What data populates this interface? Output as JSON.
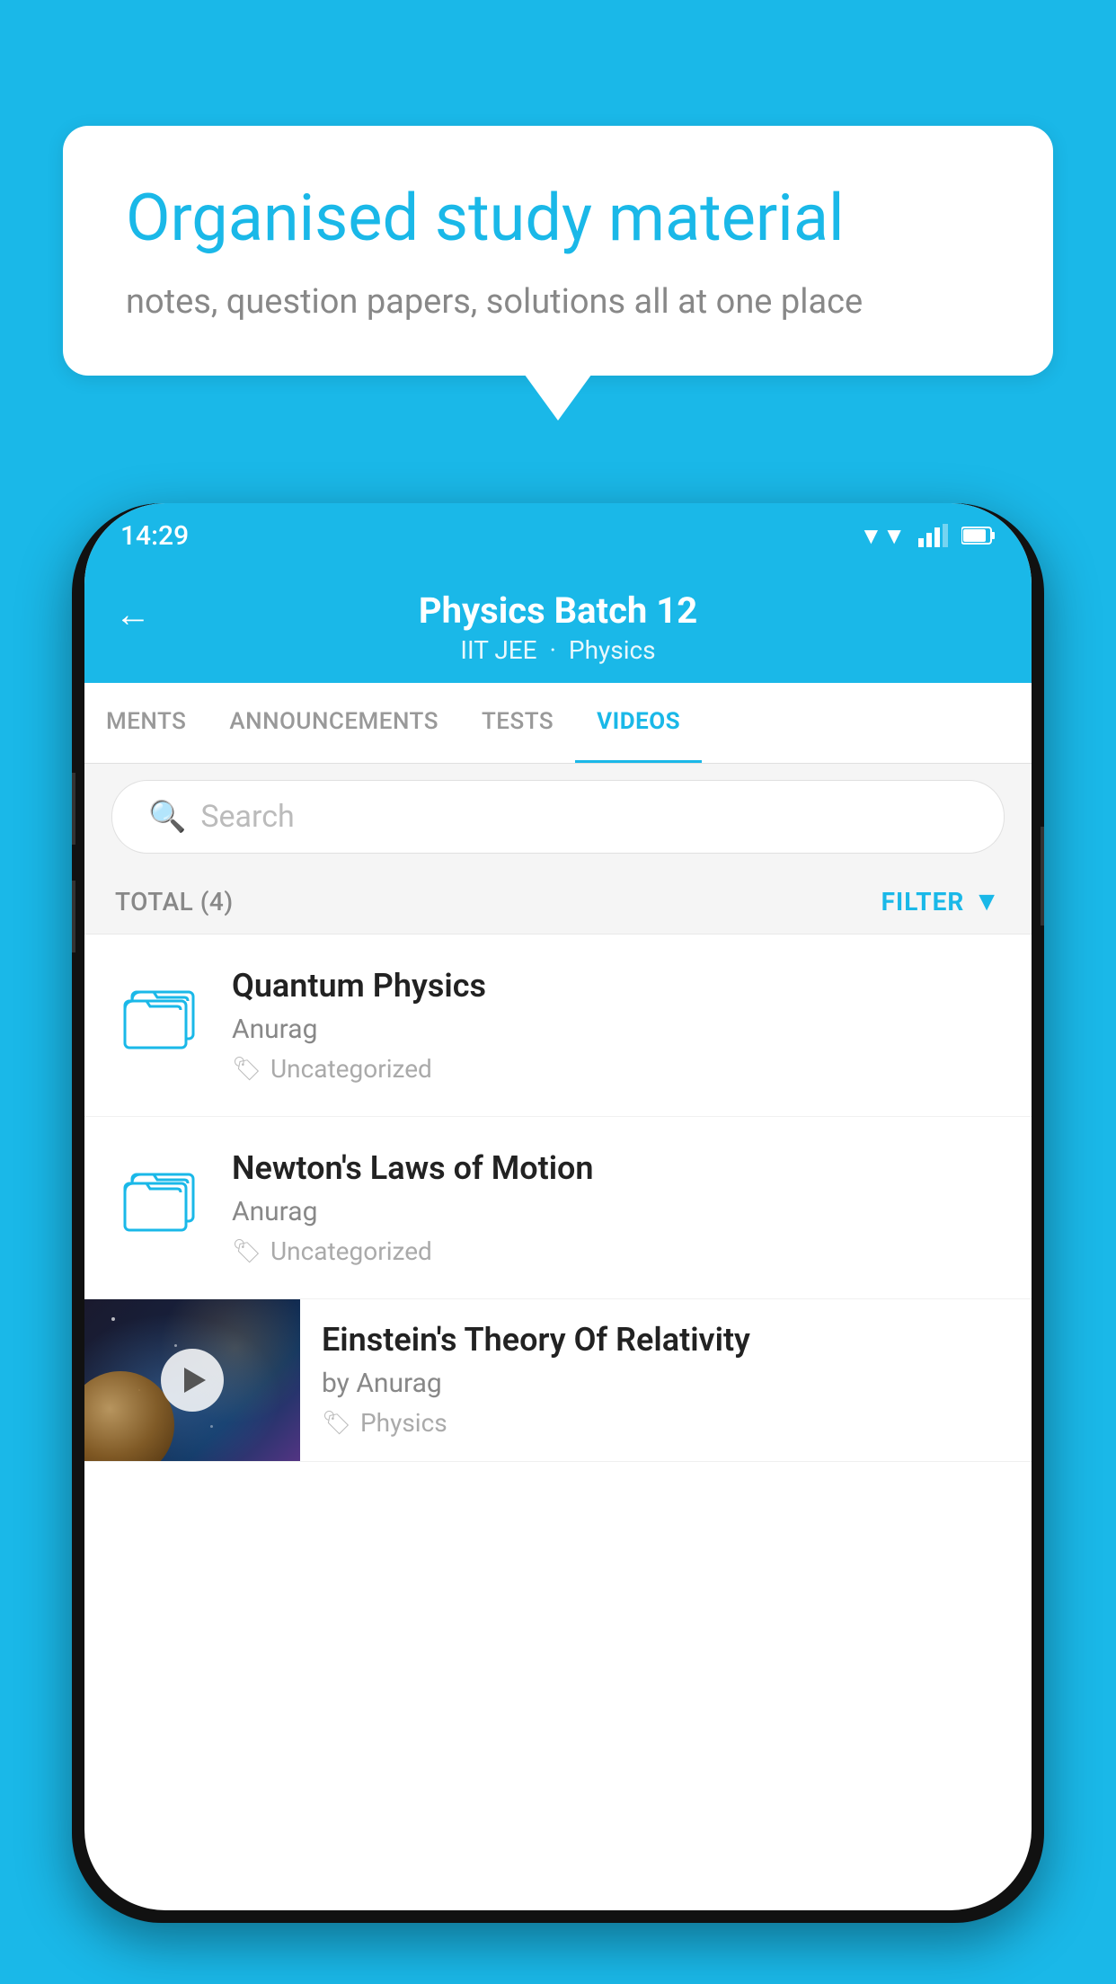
{
  "background_color": "#1ab8e8",
  "speech_bubble": {
    "title": "Organised study material",
    "subtitle": "notes, question papers, solutions all at one place"
  },
  "status_bar": {
    "time": "14:29",
    "icons": [
      "wifi",
      "signal",
      "battery"
    ]
  },
  "app_header": {
    "title": "Physics Batch 12",
    "subtitle_part1": "IIT JEE",
    "subtitle_part2": "Physics",
    "back_label": "←"
  },
  "tabs": [
    {
      "label": "MENTS",
      "active": false
    },
    {
      "label": "ANNOUNCEMENTS",
      "active": false
    },
    {
      "label": "TESTS",
      "active": false
    },
    {
      "label": "VIDEOS",
      "active": true
    }
  ],
  "search": {
    "placeholder": "Search"
  },
  "filter_row": {
    "total_label": "TOTAL (4)",
    "filter_label": "FILTER"
  },
  "videos": [
    {
      "id": 1,
      "title": "Quantum Physics",
      "author": "Anurag",
      "tag": "Uncategorized",
      "has_thumbnail": false
    },
    {
      "id": 2,
      "title": "Newton's Laws of Motion",
      "author": "Anurag",
      "tag": "Uncategorized",
      "has_thumbnail": false
    },
    {
      "id": 3,
      "title": "Einstein's Theory Of Relativity",
      "author": "by Anurag",
      "tag": "Physics",
      "has_thumbnail": true
    }
  ]
}
